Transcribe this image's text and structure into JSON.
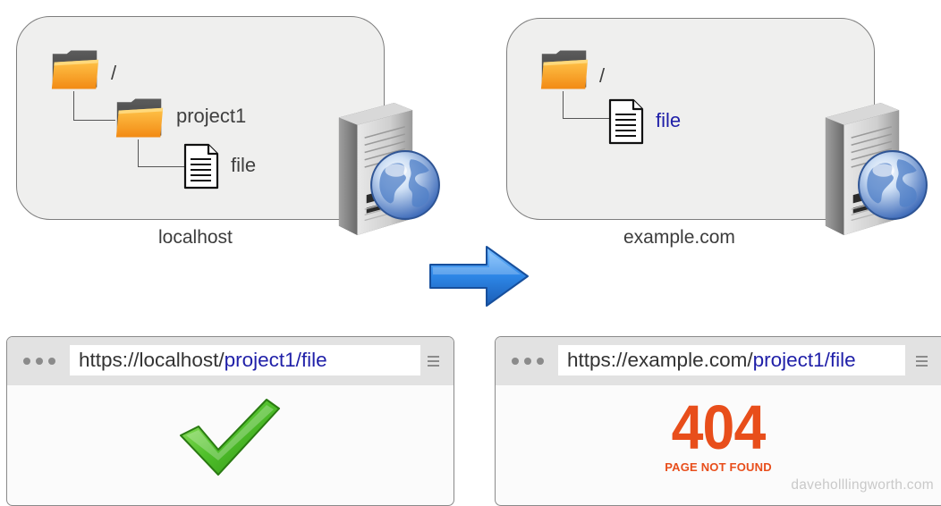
{
  "left_server": {
    "root_label": "/",
    "folder_label": "project1",
    "file_label": "file",
    "host_label": "localhost"
  },
  "right_server": {
    "root_label": "/",
    "file_label": "file",
    "host_label": "example.com"
  },
  "left_browser": {
    "url_base": "https://localhost/",
    "url_path": "project1/file",
    "result": "success"
  },
  "right_browser": {
    "url_base": "https://example.com/",
    "url_path": "project1/file",
    "error_code": "404",
    "error_text": "PAGE NOT FOUND"
  },
  "watermark": "daveholllingworth.com",
  "icons": [
    "folder-icon",
    "file-icon",
    "server-icon",
    "globe-icon",
    "arrow-right-icon",
    "checkmark-icon",
    "menu-icon"
  ],
  "colors": {
    "link_blue": "#1f1fa8",
    "error_red": "#e84e1b",
    "check_green": "#4fbf2a",
    "arrow_blue": "#2a7fd8"
  }
}
